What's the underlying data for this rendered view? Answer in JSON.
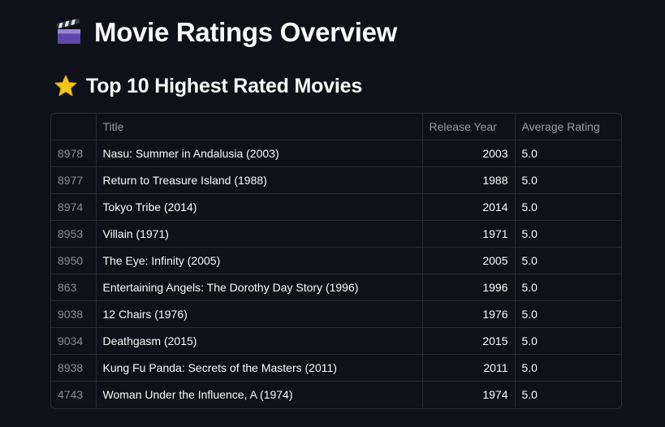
{
  "page": {
    "title": "Movie Ratings Overview",
    "title_icon": "clapper-board-icon",
    "section_title": "Top 10 Highest Rated Movies",
    "section_icon": "star-icon"
  },
  "table": {
    "columns": [
      "",
      "Title",
      "Release Year",
      "Average Rating"
    ],
    "rows": [
      {
        "index": "8978",
        "title": "Nasu: Summer in Andalusia (2003)",
        "year": "2003",
        "rating": "5.0"
      },
      {
        "index": "8977",
        "title": "Return to Treasure Island (1988)",
        "year": "1988",
        "rating": "5.0"
      },
      {
        "index": "8974",
        "title": "Tokyo Tribe (2014)",
        "year": "2014",
        "rating": "5.0"
      },
      {
        "index": "8953",
        "title": "Villain (1971)",
        "year": "1971",
        "rating": "5.0"
      },
      {
        "index": "8950",
        "title": "The Eye: Infinity (2005)",
        "year": "2005",
        "rating": "5.0"
      },
      {
        "index": "863",
        "title": "Entertaining Angels: The Dorothy Day Story (1996)",
        "year": "1996",
        "rating": "5.0"
      },
      {
        "index": "9038",
        "title": "12 Chairs (1976)",
        "year": "1976",
        "rating": "5.0"
      },
      {
        "index": "9034",
        "title": "Deathgasm (2015)",
        "year": "2015",
        "rating": "5.0"
      },
      {
        "index": "8938",
        "title": "Kung Fu Panda: Secrets of the Masters (2011)",
        "year": "2011",
        "rating": "5.0"
      },
      {
        "index": "4743",
        "title": "Woman Under the Influence, A (1974)",
        "year": "1974",
        "rating": "5.0"
      }
    ]
  },
  "colors": {
    "background": "#0e1117",
    "text": "#fafafa",
    "muted_text": "#9a9ca3",
    "border": "#262a33",
    "star": "#f5c518"
  }
}
